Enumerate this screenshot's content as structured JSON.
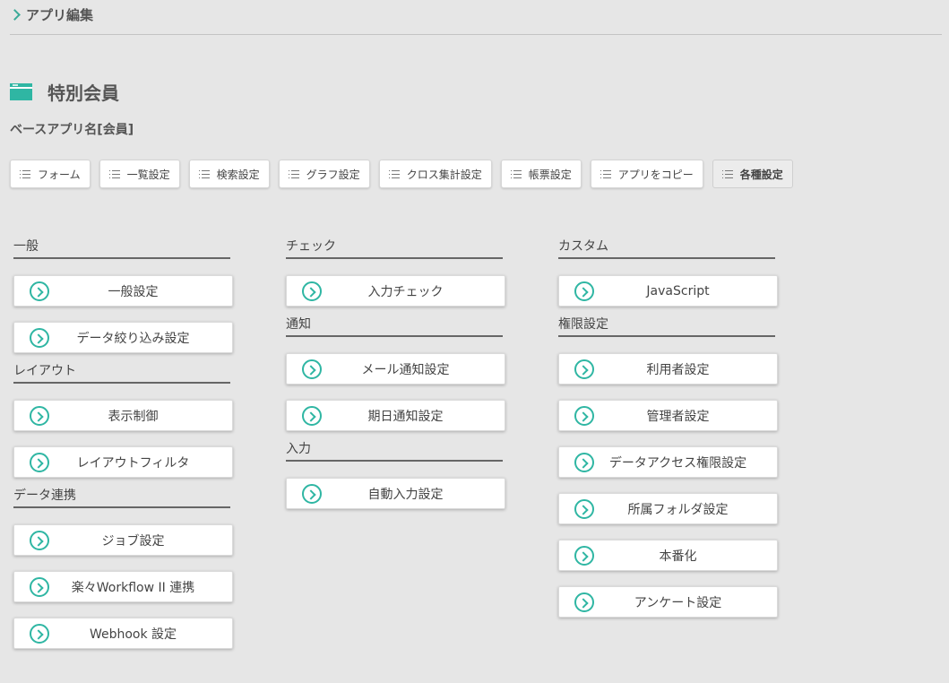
{
  "breadcrumb": {
    "label": "アプリ編集"
  },
  "app": {
    "title": "特別会員",
    "base_name": "ベースアプリ名[会員]"
  },
  "toolbar": [
    {
      "label": "フォーム",
      "active": false
    },
    {
      "label": "一覧設定",
      "active": false
    },
    {
      "label": "検索設定",
      "active": false
    },
    {
      "label": "グラフ設定",
      "active": false
    },
    {
      "label": "クロス集計設定",
      "active": false
    },
    {
      "label": "帳票設定",
      "active": false
    },
    {
      "label": "アプリをコピー",
      "active": false
    },
    {
      "label": "各種設定",
      "active": true
    }
  ],
  "columns": [
    [
      {
        "title": "一般",
        "items": [
          "一般設定",
          "データ絞り込み設定"
        ]
      },
      {
        "title": "レイアウト",
        "items": [
          "表示制御",
          "レイアウトフィルタ"
        ]
      },
      {
        "title": "データ連携",
        "items": [
          "ジョブ設定",
          "楽々Workflow II 連携",
          "Webhook 設定"
        ]
      }
    ],
    [
      {
        "title": "チェック",
        "items": [
          "入力チェック"
        ]
      },
      {
        "title": "通知",
        "items": [
          "メール通知設定",
          "期日通知設定"
        ]
      },
      {
        "title": "入力",
        "items": [
          "自動入力設定"
        ]
      }
    ],
    [
      {
        "title": "カスタム",
        "items": [
          "JavaScript"
        ]
      },
      {
        "title": "権限設定",
        "items": [
          "利用者設定",
          "管理者設定",
          "データアクセス権限設定",
          "所属フォルダ設定",
          "本番化",
          "アンケート設定"
        ]
      }
    ]
  ],
  "colors": {
    "accent": "#2fb6a3",
    "background": "#e6e6e6"
  }
}
